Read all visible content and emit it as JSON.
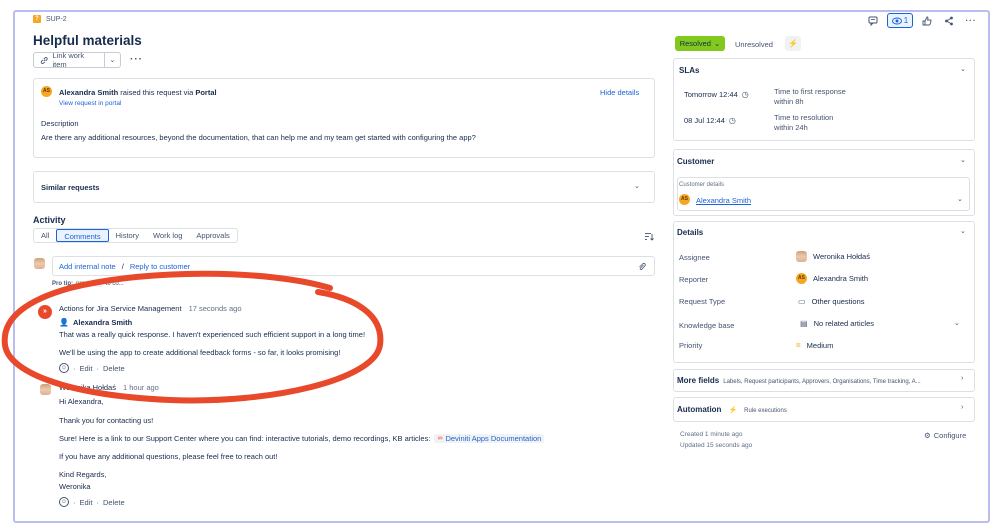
{
  "breadcrumb": {
    "key": "SUP-2"
  },
  "issue": {
    "title": "Helpful materials",
    "link_work_item": "Link work item"
  },
  "header_actions": {
    "watch_count": "1"
  },
  "request": {
    "author": "Alexandra Smith",
    "raised_text": "raised this request via",
    "channel": "Portal",
    "view_link": "View request in portal",
    "hide_details": "Hide details",
    "description_label": "Description",
    "description": "Are there any additional resources, beyond the documentation, that can help me and my team get started with configuring the app?"
  },
  "similar": {
    "label": "Similar requests"
  },
  "activity": {
    "heading": "Activity",
    "tabs": [
      "All",
      "Comments",
      "History",
      "Work log",
      "Approvals"
    ],
    "active_tab": "Comments",
    "add_internal_note": "Add internal note",
    "separator": "/",
    "reply_to_customer": "Reply to customer",
    "pro_tip_prefix": "Pro tip:",
    "pro_tip_press": "press",
    "pro_tip_key": "M",
    "pro_tip_suffix": "to co..."
  },
  "comments": [
    {
      "author": "Actions for Jira Service Management",
      "time": "17 seconds ago",
      "on_behalf": "Alexandra Smith",
      "lines": [
        "That was a really quick response. I haven't experienced such efficient support in a long time!",
        "We'll be using the app to create additional feedback forms - so far, it looks promising!"
      ],
      "edit": "Edit",
      "delete": "Delete"
    },
    {
      "author": "Weronika Hołdaś",
      "time": "1 hour ago",
      "greeting": "Hi Alexandra,",
      "thanks": "Thank you for contacting us!",
      "body_prefix": "Sure! Here is a link to our Support Center where you can find: interactive tutorials, demo recordings, KB articles:",
      "link_text": "Deviniti Apps Documentation",
      "followup": "If you have any additional questions, please feel free to reach out!",
      "signoff": "Kind Regards,",
      "signature": "Weronika",
      "edit": "Edit",
      "delete": "Delete"
    }
  ],
  "status": {
    "current": "Resolved",
    "alternative": "Unresolved"
  },
  "slas": {
    "title": "SLAs",
    "items": [
      {
        "when": "Tomorrow 12:44",
        "goal": "Time to first response",
        "within": "within 8h"
      },
      {
        "when": "08 Jul 12:44",
        "goal": "Time to resolution",
        "within": "within 24h"
      }
    ]
  },
  "customer": {
    "title": "Customer",
    "details_label": "Customer details",
    "name": "Alexandra Smith",
    "initials": "AS"
  },
  "details": {
    "title": "Details",
    "assignee_label": "Assignee",
    "assignee": "Weronika Hołdaś",
    "reporter_label": "Reporter",
    "reporter": "Alexandra Smith",
    "request_type_label": "Request Type",
    "request_type": "Other questions",
    "kb_label": "Knowledge base",
    "kb": "No related articles",
    "priority_label": "Priority",
    "priority": "Medium"
  },
  "more_fields": {
    "title": "More fields",
    "summary": "Labels, Request participants, Approvers, Organisations, Time tracking, A..."
  },
  "automation": {
    "title": "Automation",
    "rule": "Rule executions"
  },
  "meta": {
    "created": "Created 1 minute ago",
    "updated": "Updated 15 seconds ago",
    "configure": "Configure"
  },
  "colors": {
    "accent": "#1d63d8",
    "resolved": "#82c91e",
    "annotation": "#e8492a",
    "frame": "#b9bdf0"
  }
}
